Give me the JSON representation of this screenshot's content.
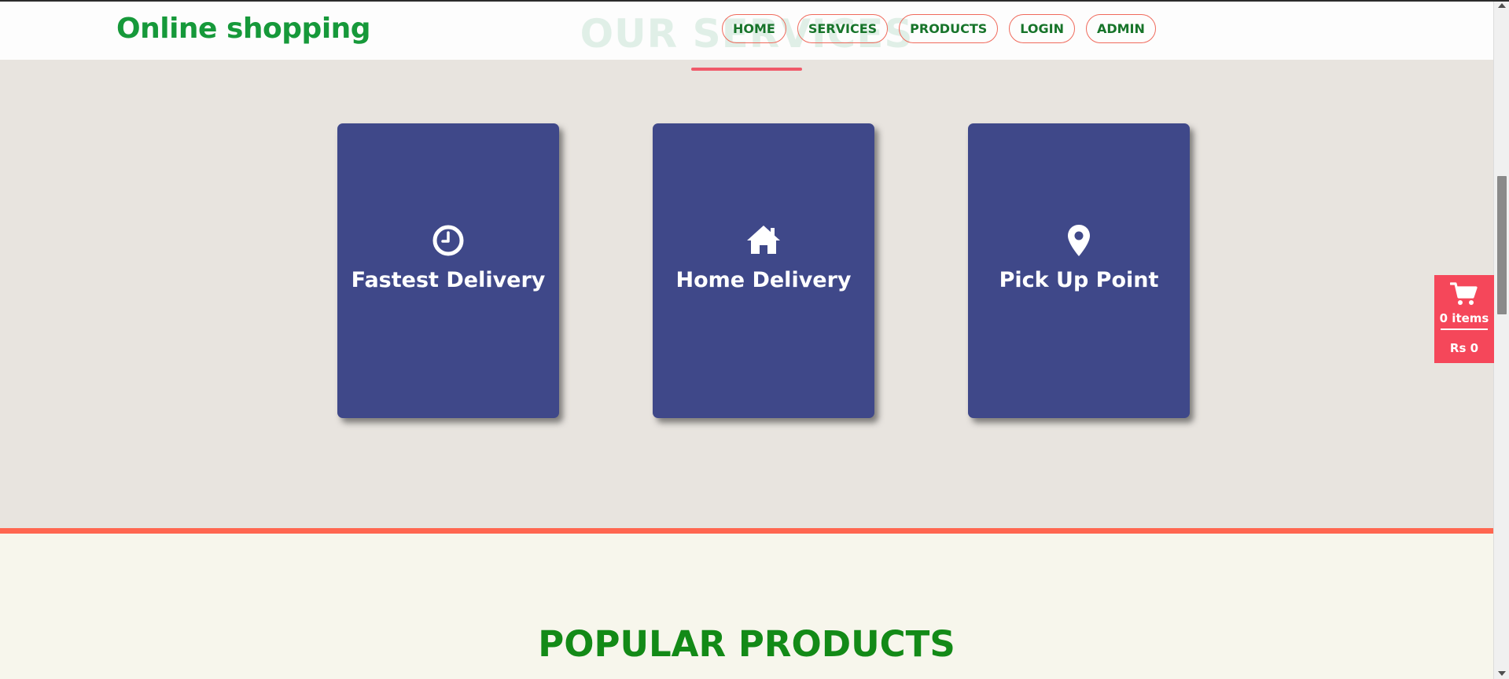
{
  "header": {
    "brand": "Online shopping",
    "nav": [
      "HOME",
      "SERVICES",
      "PRODUCTS",
      "LOGIN",
      "ADMIN"
    ]
  },
  "services": {
    "title": "OUR SERVICES",
    "cards": [
      {
        "label": "Fastest Delivery",
        "icon": "clock-icon"
      },
      {
        "label": "Home Delivery",
        "icon": "home-icon"
      },
      {
        "label": "Pick Up Point",
        "icon": "map-marker-icon"
      }
    ]
  },
  "popular": {
    "title": "POPULAR PRODUCTS"
  },
  "cart": {
    "items": "0 items",
    "total": "Rs 0",
    "icon": "shopping-cart-icon"
  },
  "colors": {
    "brand": "#16993a",
    "card": "#3f4889",
    "accent": "#f5475a",
    "divider": "#ff6650",
    "heading": "#138a17"
  }
}
